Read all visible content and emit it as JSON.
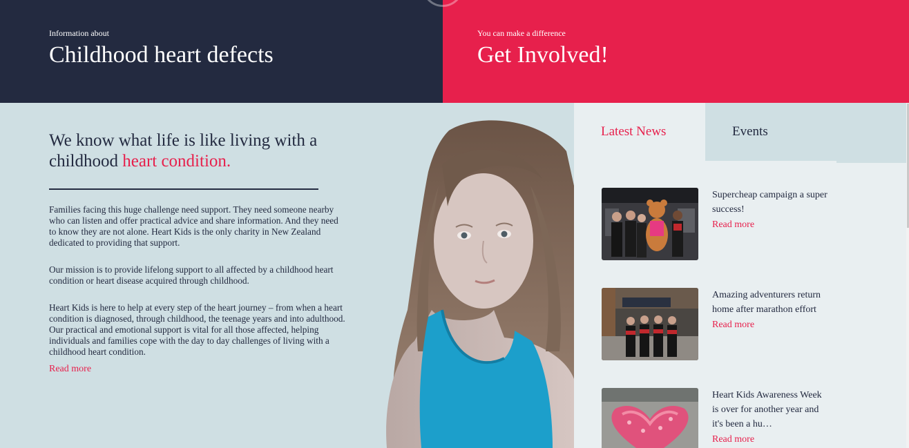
{
  "banner": {
    "left": {
      "pre_title": "Information about",
      "title": "Childhood heart defects"
    },
    "right": {
      "pre_title": "You can make a difference",
      "title": "Get Involved!"
    }
  },
  "intro": {
    "heading_part1": "We know what life is like living with a childhood ",
    "heading_accent": "heart condition.",
    "paragraphs": [
      "Families facing this huge challenge need support. They need someone nearby who can listen and offer practical advice and share information. And they need to know they are not alone. Heart Kids is the only charity in New Zealand dedicated to providing that support.",
      "Our mission is to provide lifelong support to all affected by a childhood heart condition or heart disease acquired through childhood.",
      "Heart Kids is here to help at every step of the heart journey – from when a heart condition is diagnosed, through childhood, the teenage years and into adulthood. Our practical and emotional support is vital for all those affected, helping individuals and families cope with the day to day challenges of living with a childhood heart condition."
    ],
    "read_more": "Read more"
  },
  "news_panel": {
    "tabs": [
      {
        "label": "Latest News",
        "active": true
      },
      {
        "label": "Events",
        "active": false
      }
    ],
    "items": [
      {
        "title": "Supercheap campaign a super success!",
        "read_more": "Read more"
      },
      {
        "title": "Amazing adventurers return home after marathon effort",
        "read_more": "Read more"
      },
      {
        "title": "Heart Kids Awareness Week is over for another year and it's been a hu…",
        "read_more": "Read more"
      }
    ]
  },
  "colors": {
    "navy": "#232a40",
    "accent_red": "#e7204c",
    "light_blue": "#cfdfe3",
    "panel_bg": "#e9eff1"
  }
}
